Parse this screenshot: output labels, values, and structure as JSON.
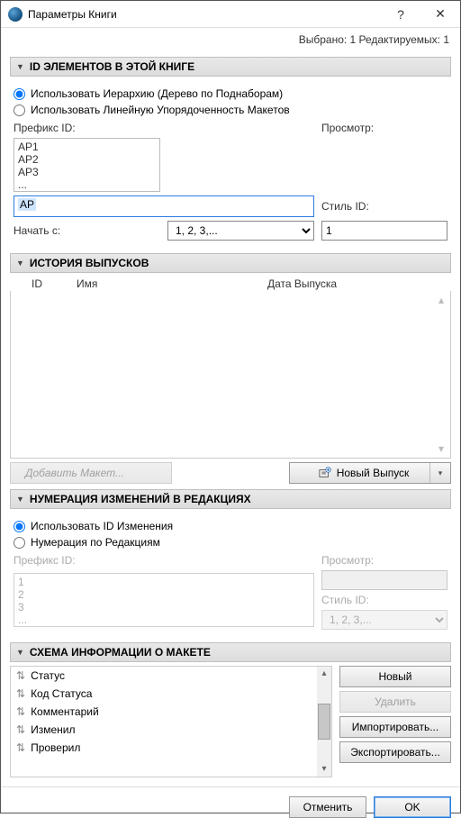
{
  "window": {
    "title": "Параметры Книги"
  },
  "status": {
    "text": "Выбрано: 1 Редактируемых: 1"
  },
  "section": {
    "idelems": {
      "title": "ID ЭЛЕМЕНТОВ В ЭТОЙ КНИГЕ"
    },
    "history": {
      "title": "ИСТОРИЯ ВЫПУСКОВ"
    },
    "numbering": {
      "title": "НУМЕРАЦИЯ ИЗМЕНЕНИЙ В РЕДАКЦИЯХ"
    },
    "schema": {
      "title": "СХЕМА ИНФОРМАЦИИ О МАКЕТЕ"
    }
  },
  "idelems": {
    "radio_hier": "Использовать Иерархию (Дерево по Поднаборам)",
    "radio_lin": "Использовать Линейную Упорядоченность Макетов",
    "prefix_label": "Префикс ID:",
    "prefix_value": "АР",
    "style_label": "Стиль ID:",
    "style_value": "1, 2, 3,...",
    "start_label": "Начать с:",
    "start_value": "1",
    "preview_label": "Просмотр:",
    "preview_items": [
      "АР1",
      "АР2",
      "АР3",
      "..."
    ]
  },
  "history": {
    "cols": {
      "id": "ID",
      "name": "Имя",
      "date": "Дата Выпуска"
    },
    "add_label": "Добавить Макет...",
    "new_label": "Новый Выпуск"
  },
  "numbering": {
    "radio_change": "Использовать ID Изменения",
    "radio_rev": "Нумерация по Редакциям",
    "prefix_label": "Префикс ID:",
    "prefix_value": "",
    "style_label": "Стиль ID:",
    "style_value": "1, 2, 3,...",
    "preview_label": "Просмотр:",
    "preview_items": [
      "1",
      "2",
      "3",
      "..."
    ]
  },
  "schema": {
    "items": [
      "Статус",
      "Код Статуса",
      "Комментарий",
      "Изменил",
      "Проверил"
    ],
    "new": "Новый",
    "delete": "Удалить",
    "import": "Импортировать...",
    "export": "Экспортировать..."
  },
  "dialog": {
    "cancel": "Отменить",
    "ok": "OK"
  }
}
